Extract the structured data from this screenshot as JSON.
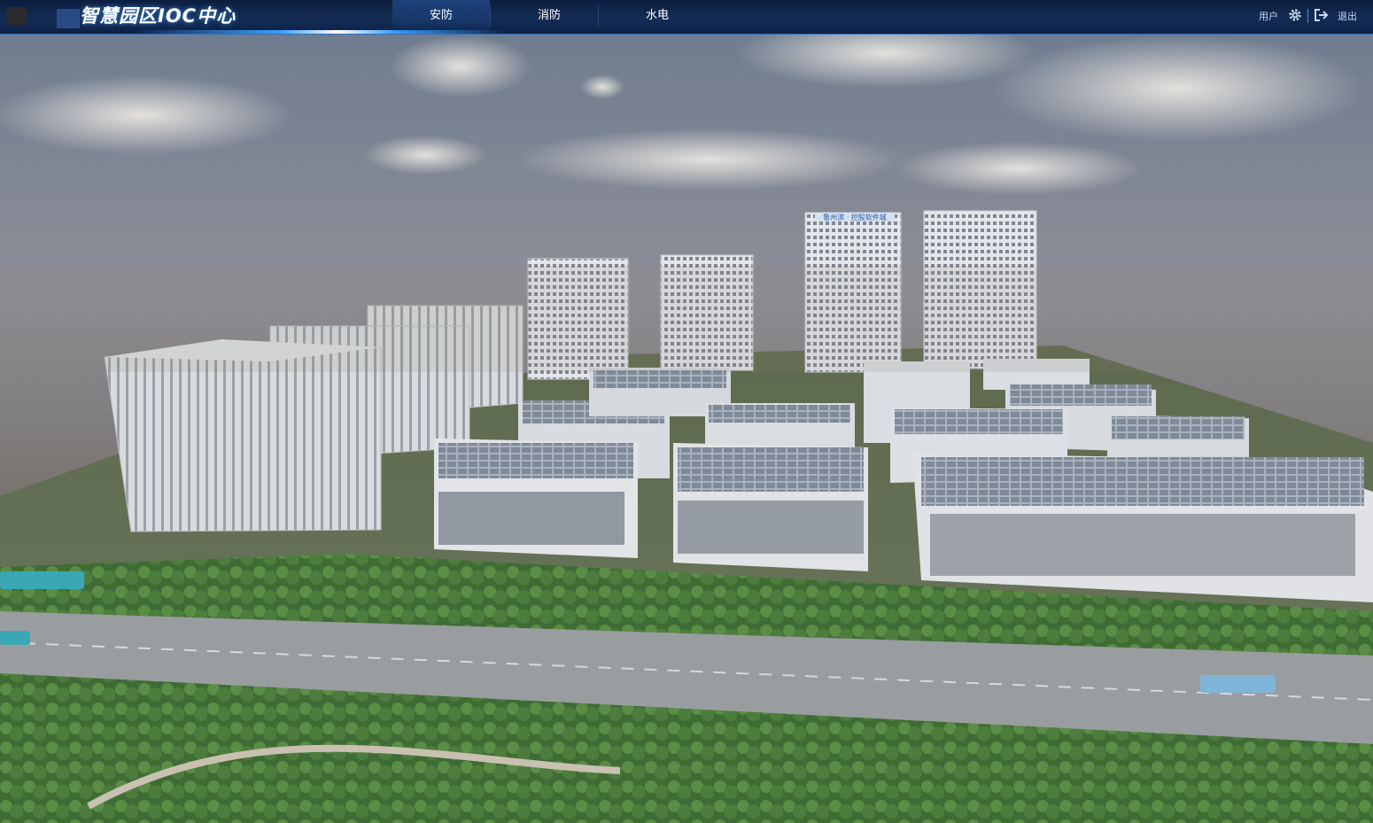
{
  "app": {
    "title": "智慧园区IOC中心"
  },
  "nav": {
    "items": [
      {
        "label": "安防",
        "active": true
      },
      {
        "label": "消防",
        "active": false
      },
      {
        "label": "水电",
        "active": false
      }
    ]
  },
  "user": {
    "label": "用户",
    "logout_label": "退出"
  },
  "scene": {
    "building_signs": [
      "鲁州滨 · 控股软件城"
    ]
  },
  "colors": {
    "topbar": "#142c55",
    "accent": "#3aa0ff",
    "text": "#ffffff"
  },
  "icons": [
    "gear-icon",
    "logout-icon"
  ]
}
